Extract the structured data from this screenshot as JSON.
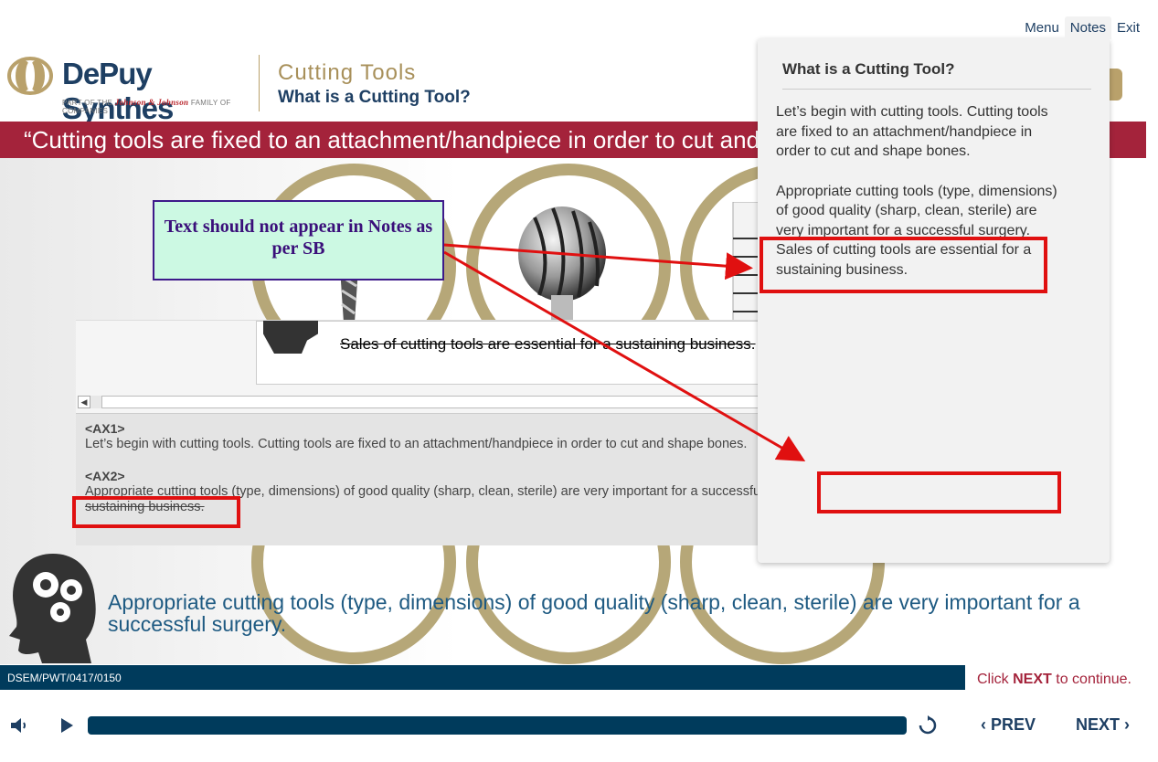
{
  "nav": {
    "menu": "Menu",
    "notes": "Notes",
    "exit": "Exit"
  },
  "brand": {
    "name": "DePuy Synthes",
    "sub_prefix": "PART OF THE",
    "sub_jj": "Johnson & Johnson",
    "sub_suffix": "FAMILY OF COMPANIES"
  },
  "header": {
    "course": "Cutting Tools",
    "page": "What is a Cutting Tool?"
  },
  "banner": {
    "quote": "“Cutting tools are fixed to an attachment/handpiece in order to cut and shape bones."
  },
  "review": {
    "slide_text": "Sales of cutting tools are essential for a sustaining business.",
    "ax1_label": "<AX1>",
    "ax1_text": "Let’s begin with cutting tools. Cutting tools are fixed to an attachment/handpiece in order to cut and shape bones.",
    "ax2_label": "<AX2>",
    "ax2_text": "Appropriate cutting tools (type, dimensions) of good quality (sharp, clean, sterile) are very important for a successful surgery.",
    "ax2_struck": "Sales of cutting tools are essential for a sustaining business."
  },
  "annotation": {
    "callout": "Text should not appear in Notes as per SB"
  },
  "notes_popup": {
    "title": "What is a Cutting Tool?",
    "para1": "Let’s begin with cutting tools. Cutting tools are fixed to an attachment/handpiece in order to cut and shape bones.",
    "para2": "Appropriate cutting tools (type, dimensions) of good quality (sharp, clean, sterile) are very important for a successful surgery.",
    "para3": "Sales of cutting tools are essential for a sustaining business."
  },
  "subtitle": "Appropriate cutting tools (type, dimensions) of good quality (sharp, clean, sterile) are very important for a successful surgery.",
  "footer": {
    "code": "DSEM/PWT/0417/0150",
    "hint_click": "Click",
    "hint_next": "NEXT",
    "hint_rest": "to continue."
  },
  "controls": {
    "prev": "PREV",
    "next": "NEXT"
  },
  "colors": {
    "navy": "#003b5c",
    "brand_red": "#a4233b",
    "gold": "#b6a778",
    "annotation_red": "#e01010"
  }
}
